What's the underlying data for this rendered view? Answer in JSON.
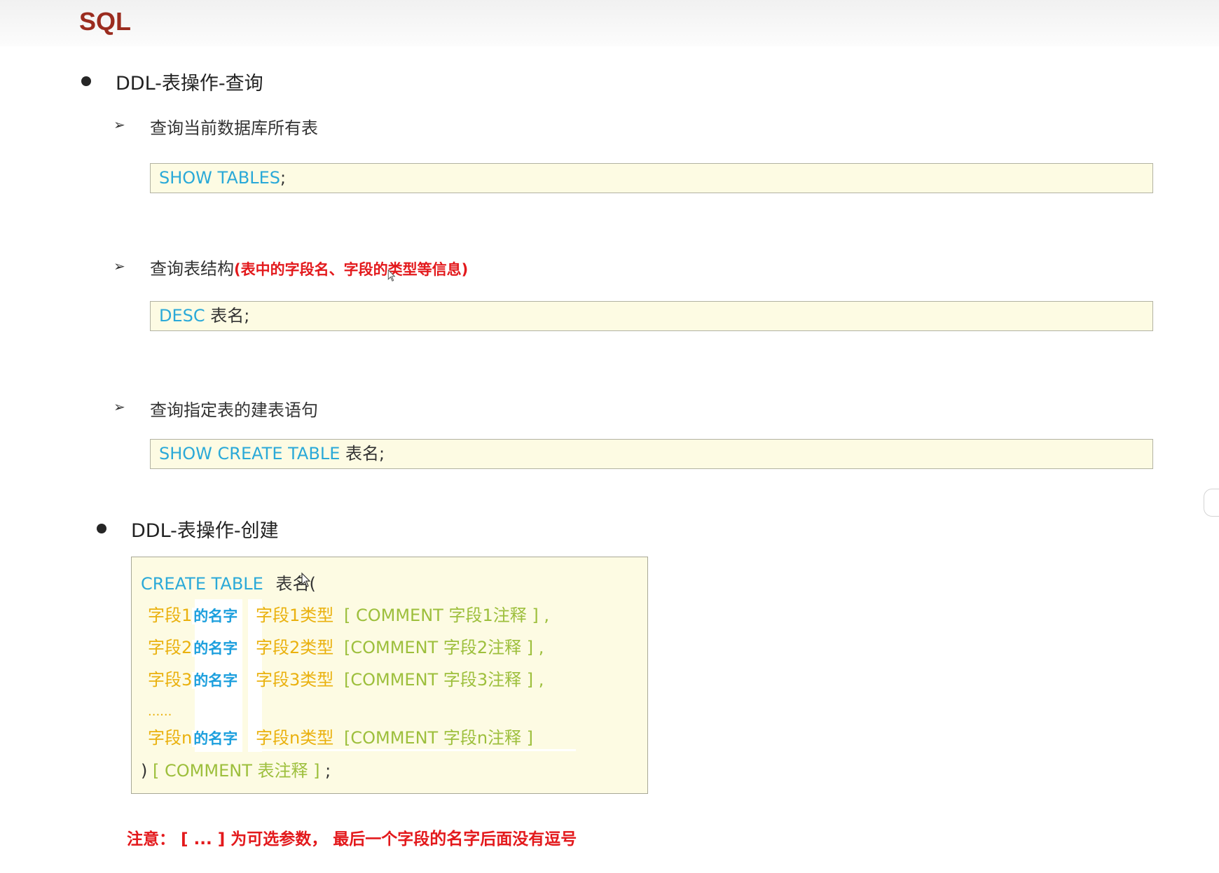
{
  "page_title": "SQL",
  "sections": [
    {
      "heading": "DDL-表操作-查询",
      "items": [
        {
          "label": "查询当前数据库所有表",
          "note": "",
          "code_keyword": "SHOW TABLES",
          "code_rest": ";"
        },
        {
          "label": "查询表结构",
          "note": "(表中的字段名、字段的类型等信息)",
          "code_keyword": "DESC",
          "code_rest": " 表名;"
        },
        {
          "label": "查询指定表的建表语句",
          "note": "",
          "code_keyword": "SHOW CREATE TABLE",
          "code_rest": " 表名;"
        }
      ]
    },
    {
      "heading": "DDL-表操作-创建"
    }
  ],
  "create_block": {
    "line0_kw": "CREATE TABLE",
    "line0_rest": "表名(",
    "fields": [
      {
        "f": "字段1",
        "name": "的名字",
        "type": "字段1类型",
        "opt": "[ COMMENT  字段1注释 ] ,"
      },
      {
        "f": "字段2",
        "name": "的名字",
        "type": "字段2类型",
        "opt": "[COMMENT  字段2注释 ] ,"
      },
      {
        "f": "字段3",
        "name": "的名字",
        "type": "字段3类型",
        "opt": "[COMMENT  字段3注释 ] ,"
      },
      {
        "f": "字段n",
        "name": "的名字",
        "type": "字段n类型",
        "opt": "[COMMENT  字段n注释 ]"
      }
    ],
    "ellipsis": "......",
    "close_paren": ")",
    "close_opt": "[ COMMENT  表注释 ]",
    "close_semicolon": ";"
  },
  "note": {
    "part1": "注意：  [ ... ] 为可选参数，  最后一个字段",
    "part2": "的名字",
    "part3": "后面没有逗号"
  },
  "icons": {
    "bullet": "filled-circle",
    "arrow": "➢"
  }
}
